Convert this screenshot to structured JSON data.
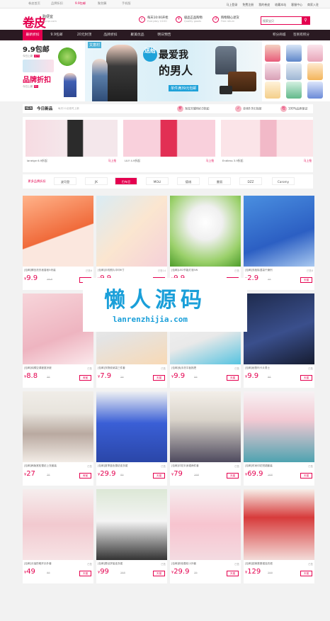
{
  "topbar": {
    "links": [
      "卷皮首页",
      "品牌折扣",
      "9.9包邮",
      "聚划算",
      "手机版"
    ],
    "right_links": [
      "马上登录",
      "免费注册",
      "我的卷皮",
      "收藏本站",
      "客服中心",
      "商家入驻"
    ]
  },
  "header": {
    "logo": "卷皮",
    "logo_sub": "购便宜",
    "logo_en": "juanpi.com",
    "services": [
      {
        "icon": "✓",
        "title": "每天10:00开抢",
        "sub": "Everyday 10:00"
      },
      {
        "icon": "¥",
        "title": "极品正品购物",
        "sub": "Quality goods"
      },
      {
        "icon": "↺",
        "title": "购物随心退货",
        "sub": "Free return"
      }
    ],
    "search_placeholder": "搜索宝贝",
    "search_icon": "search-icon"
  },
  "nav": {
    "items": [
      "最新折扣",
      "9.9包邮",
      "20元封顶",
      "品牌折扣",
      "聚美优品",
      "明日预告"
    ],
    "right": [
      "积分商城",
      "签到有积分"
    ]
  },
  "banner": {
    "left_promos": [
      {
        "big": "9.9包邮",
        "note": "今日上新",
        "count": "377"
      },
      {
        "big": "品牌折扣",
        "note": "今日上新",
        "count": "91"
      }
    ],
    "hero_line1": "最爱我",
    "hero_line2": "的男人",
    "hero_bubble": "送给",
    "hero_badge": "单件满39元包邮",
    "tag": "文意村"
  },
  "ribbon": {
    "new_tag": "NEW",
    "label": "今日新品",
    "sub": "每天12点准时上新",
    "features": [
      {
        "icon": "折",
        "text": "淘宝天猫特价3折起"
      },
      {
        "icon": "✓",
        "text": "全场9.9元包邮"
      },
      {
        "icon": "检",
        "text": "100%品质保证"
      }
    ]
  },
  "brand_cards": [
    {
      "name": "laneige 6.9折起",
      "go": "马上抢"
    },
    {
      "name": "LILY 4.9折起",
      "go": "马上抢"
    },
    {
      "name": "Endless 3.9折起",
      "go": "马上抢"
    }
  ],
  "brand_strip": [
    "更多品牌折扣",
    "波司登",
    "JK",
    "巴布豆",
    "MOLI",
    "德绒",
    "曼丽",
    "DZZ",
    "Caromy"
  ],
  "products": [
    {
      "title": "[包邮]椰岛洗衣皂香皂5块装",
      "sold": "已售6",
      "price": "9.9",
      "old": "19.9",
      "buy": "天猫"
    },
    {
      "title": "[包邮]手机照片冲印6寸",
      "sold": "已售14",
      "price": "9.9",
      "old": "29.0",
      "buy": "天猫"
    },
    {
      "title": "[包邮]LED节能灯泡5W",
      "sold": "已售",
      "price": "9.9",
      "old": "39",
      "buy": "天猫"
    },
    {
      "title": "[包邮]衣柜除湿袋干燥剂",
      "sold": "已售8",
      "price": "2.9",
      "old": "12",
      "buy": "天猫"
    },
    {
      "title": "[包邮]纯棉空调被夏凉被",
      "sold": "已售",
      "price": "8.8",
      "old": "38",
      "buy": "淘宝"
    },
    {
      "title": "[包邮]衣物收纳袋三件套",
      "sold": "已售",
      "price": "7.9",
      "old": "29",
      "buy": "天猫"
    },
    {
      "title": "[包邮]免手洗平板拖把",
      "sold": "已售",
      "price": "9.9",
      "old": "59",
      "buy": "天猫"
    },
    {
      "title": "[包邮]秘鲁玛卡片男士",
      "sold": "已售",
      "price": "9.9",
      "old": "98",
      "buy": "天猫"
    },
    {
      "title": "[包邮]韩版宽松雪纺上衣套装",
      "sold": "已售",
      "price": "27",
      "old": "78",
      "buy": "淘宝"
    },
    {
      "title": "[包邮]夏季蓝色雪纺连衣裙",
      "sold": "已售",
      "price": "29.9",
      "old": "89",
      "buy": "天猫"
    },
    {
      "title": "[包邮]印花半身裙两件套",
      "sold": "已售",
      "price": "79",
      "old": "198",
      "buy": "天猫"
    },
    {
      "title": "[包邮]时尚印花短裙套装",
      "sold": "已售",
      "price": "69.9",
      "old": "168",
      "buy": "天猫"
    },
    {
      "title": "[包邮]长袖防晒开衫外套",
      "sold": "已售",
      "price": "49",
      "old": "99",
      "buy": "天猫"
    },
    {
      "title": "[包邮]蕾丝拼接连衣裙",
      "sold": "已售",
      "price": "99",
      "old": "268",
      "buy": "天猫"
    },
    {
      "title": "[包邮]粉色雪纺小外套",
      "sold": "已售",
      "price": "29.9",
      "old": "79",
      "buy": "天猫"
    },
    {
      "title": "[包邮]甜美蓬蓬裙连衣裙",
      "sold": "已售",
      "price": "129",
      "old": "299",
      "buy": "天猫"
    }
  ],
  "watermark": {
    "cn": "懒人源码",
    "en": "lanrenzhijia.com"
  },
  "colors": {
    "accent": "#e4004f",
    "nav_bg": "#2a1a22",
    "watermark": "#1a9fd9"
  }
}
